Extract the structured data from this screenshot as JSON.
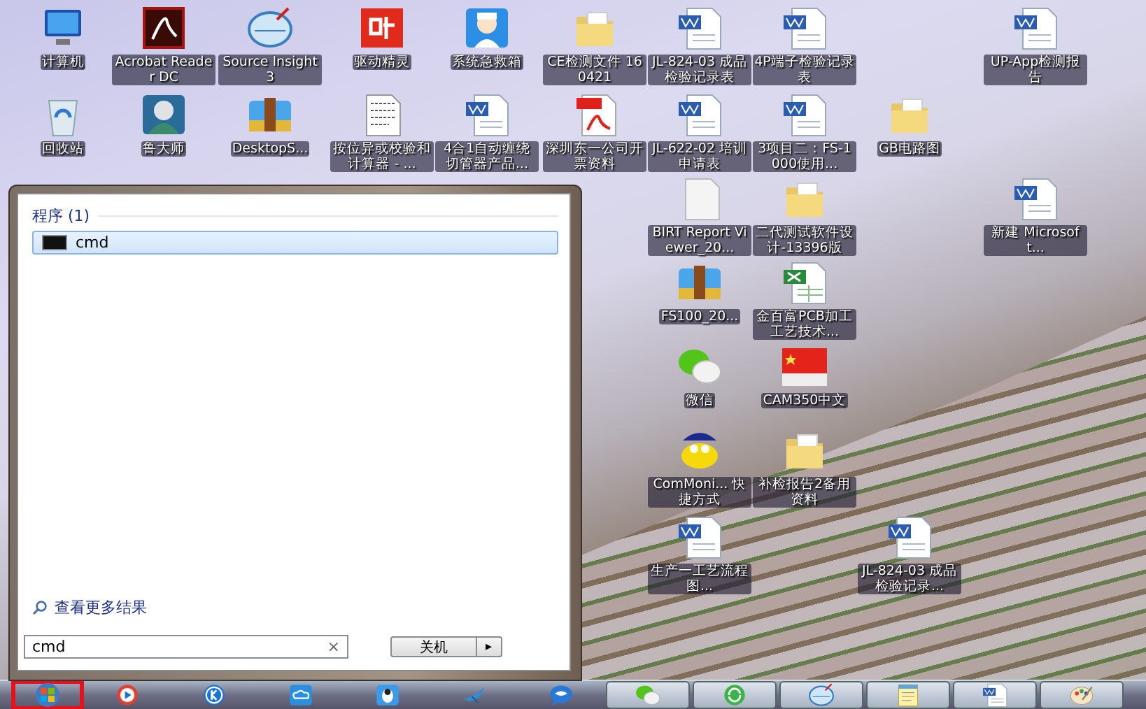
{
  "desktop_icons": [
    {
      "kind": "computer",
      "label": "计算机"
    },
    {
      "kind": "pdf-app",
      "label": "Acrobat Reader DC"
    },
    {
      "kind": "lens",
      "label": "Source Insight 3"
    },
    {
      "kind": "glyph-app",
      "label": "驱动精灵"
    },
    {
      "kind": "doctor",
      "label": "系统急救箱"
    },
    {
      "kind": "folder",
      "label": "CE检测文件 160421"
    },
    {
      "kind": "word",
      "label": "JL-824-03 成品检验记录表"
    },
    {
      "kind": "word",
      "label": "4P端子检验记录表"
    },
    {
      "kind": "word",
      "label": "UP-App检测报告"
    },
    {
      "kind": "recycle",
      "label": "回收站"
    },
    {
      "kind": "portrait-app",
      "label": "鲁大师"
    },
    {
      "kind": "archive",
      "label": "DesktopS..."
    },
    {
      "kind": "hex-doc",
      "label": "按位异或校验和计算器 - ..."
    },
    {
      "kind": "word",
      "label": "4合1自动缠绕切管器产品..."
    },
    {
      "kind": "pdf",
      "label": "深圳东一公司开票资料"
    },
    {
      "kind": "word",
      "label": "JL-622-02 培训申请表"
    },
    {
      "kind": "word",
      "label": "3项目二：FS-1000使用..."
    },
    {
      "kind": "folder",
      "label": "GB电路图"
    },
    {
      "kind": "blank-doc",
      "label": "BIRT Report Viewer_20..."
    },
    {
      "kind": "folder",
      "label": "二代测试软件设计-13396版"
    },
    {
      "kind": "word",
      "label": "新建 Microsoft..."
    },
    {
      "kind": "archive",
      "label": "FS100_20..."
    },
    {
      "kind": "excel",
      "label": "金百富PCB加工工艺技术..."
    },
    {
      "kind": "chat",
      "label": "微信"
    },
    {
      "kind": "flag",
      "label": "CAM350中文"
    },
    {
      "kind": "duck",
      "label": "ComMoni... 快捷方式"
    },
    {
      "kind": "folder",
      "label": "补检报告2备用资料"
    },
    {
      "kind": "word",
      "label": "生产一工艺流程图..."
    },
    {
      "kind": "word",
      "label": "JL-824-03 成品检验记录..."
    }
  ],
  "start_menu": {
    "section_title": "程序 (1)",
    "results": [
      {
        "label": "cmd",
        "selected": true
      }
    ],
    "more_results": "查看更多结果",
    "search": {
      "value": "cmd",
      "clear": "×"
    },
    "shutdown_button": "关机",
    "shutdown_arrow": "▸"
  },
  "taskbar": {
    "start_highlighted": true,
    "items": [
      {
        "kind": "play",
        "running": false
      },
      {
        "kind": "k",
        "running": false
      },
      {
        "kind": "cloud",
        "running": false
      },
      {
        "kind": "penguin",
        "running": false
      },
      {
        "kind": "bird",
        "running": false
      },
      {
        "kind": "bubble",
        "running": false
      },
      {
        "kind": "chat",
        "running": true
      },
      {
        "kind": "refresh",
        "running": true
      },
      {
        "kind": "lens",
        "running": true
      },
      {
        "kind": "note",
        "running": true
      },
      {
        "kind": "word",
        "running": true
      },
      {
        "kind": "paint",
        "running": true
      }
    ]
  }
}
